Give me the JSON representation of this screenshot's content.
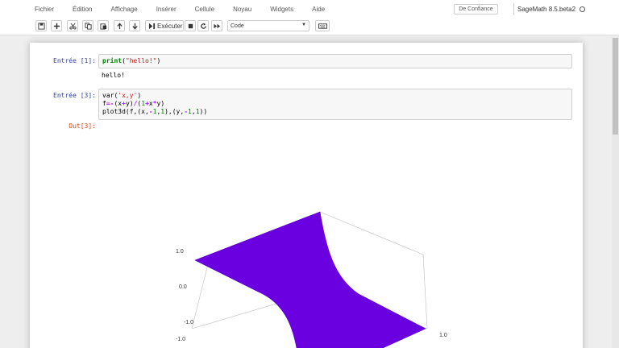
{
  "menubar": {
    "items": [
      "Fichier",
      "Édition",
      "Affichage",
      "Insérer",
      "Cellule",
      "Noyau",
      "Widgets",
      "Aide"
    ],
    "trusted_label": "De Confiance",
    "kernel_name": "SageMath 8.5.beta2"
  },
  "toolbar": {
    "run_label": "Exécuter",
    "cell_type": "Code"
  },
  "cells": [
    {
      "prompt": "Entrée [1]:",
      "code": [
        "print(\"hello!\")"
      ],
      "output": "hello!"
    },
    {
      "prompt": "Entrée [3]:",
      "code": [
        "var('x,y')",
        "f=-(x+y)/(1+x*y)",
        "plot3d(f,(x,-1,1),(y,-1,1))"
      ],
      "out_prompt": "Out[3]:"
    }
  ],
  "plot": {
    "z_ticks": [
      "1.0",
      "0.0",
      "-1.0"
    ],
    "x_tick_left": "-1.0",
    "x_tick_right": "1.0",
    "surface_color": "#6a00e0"
  }
}
